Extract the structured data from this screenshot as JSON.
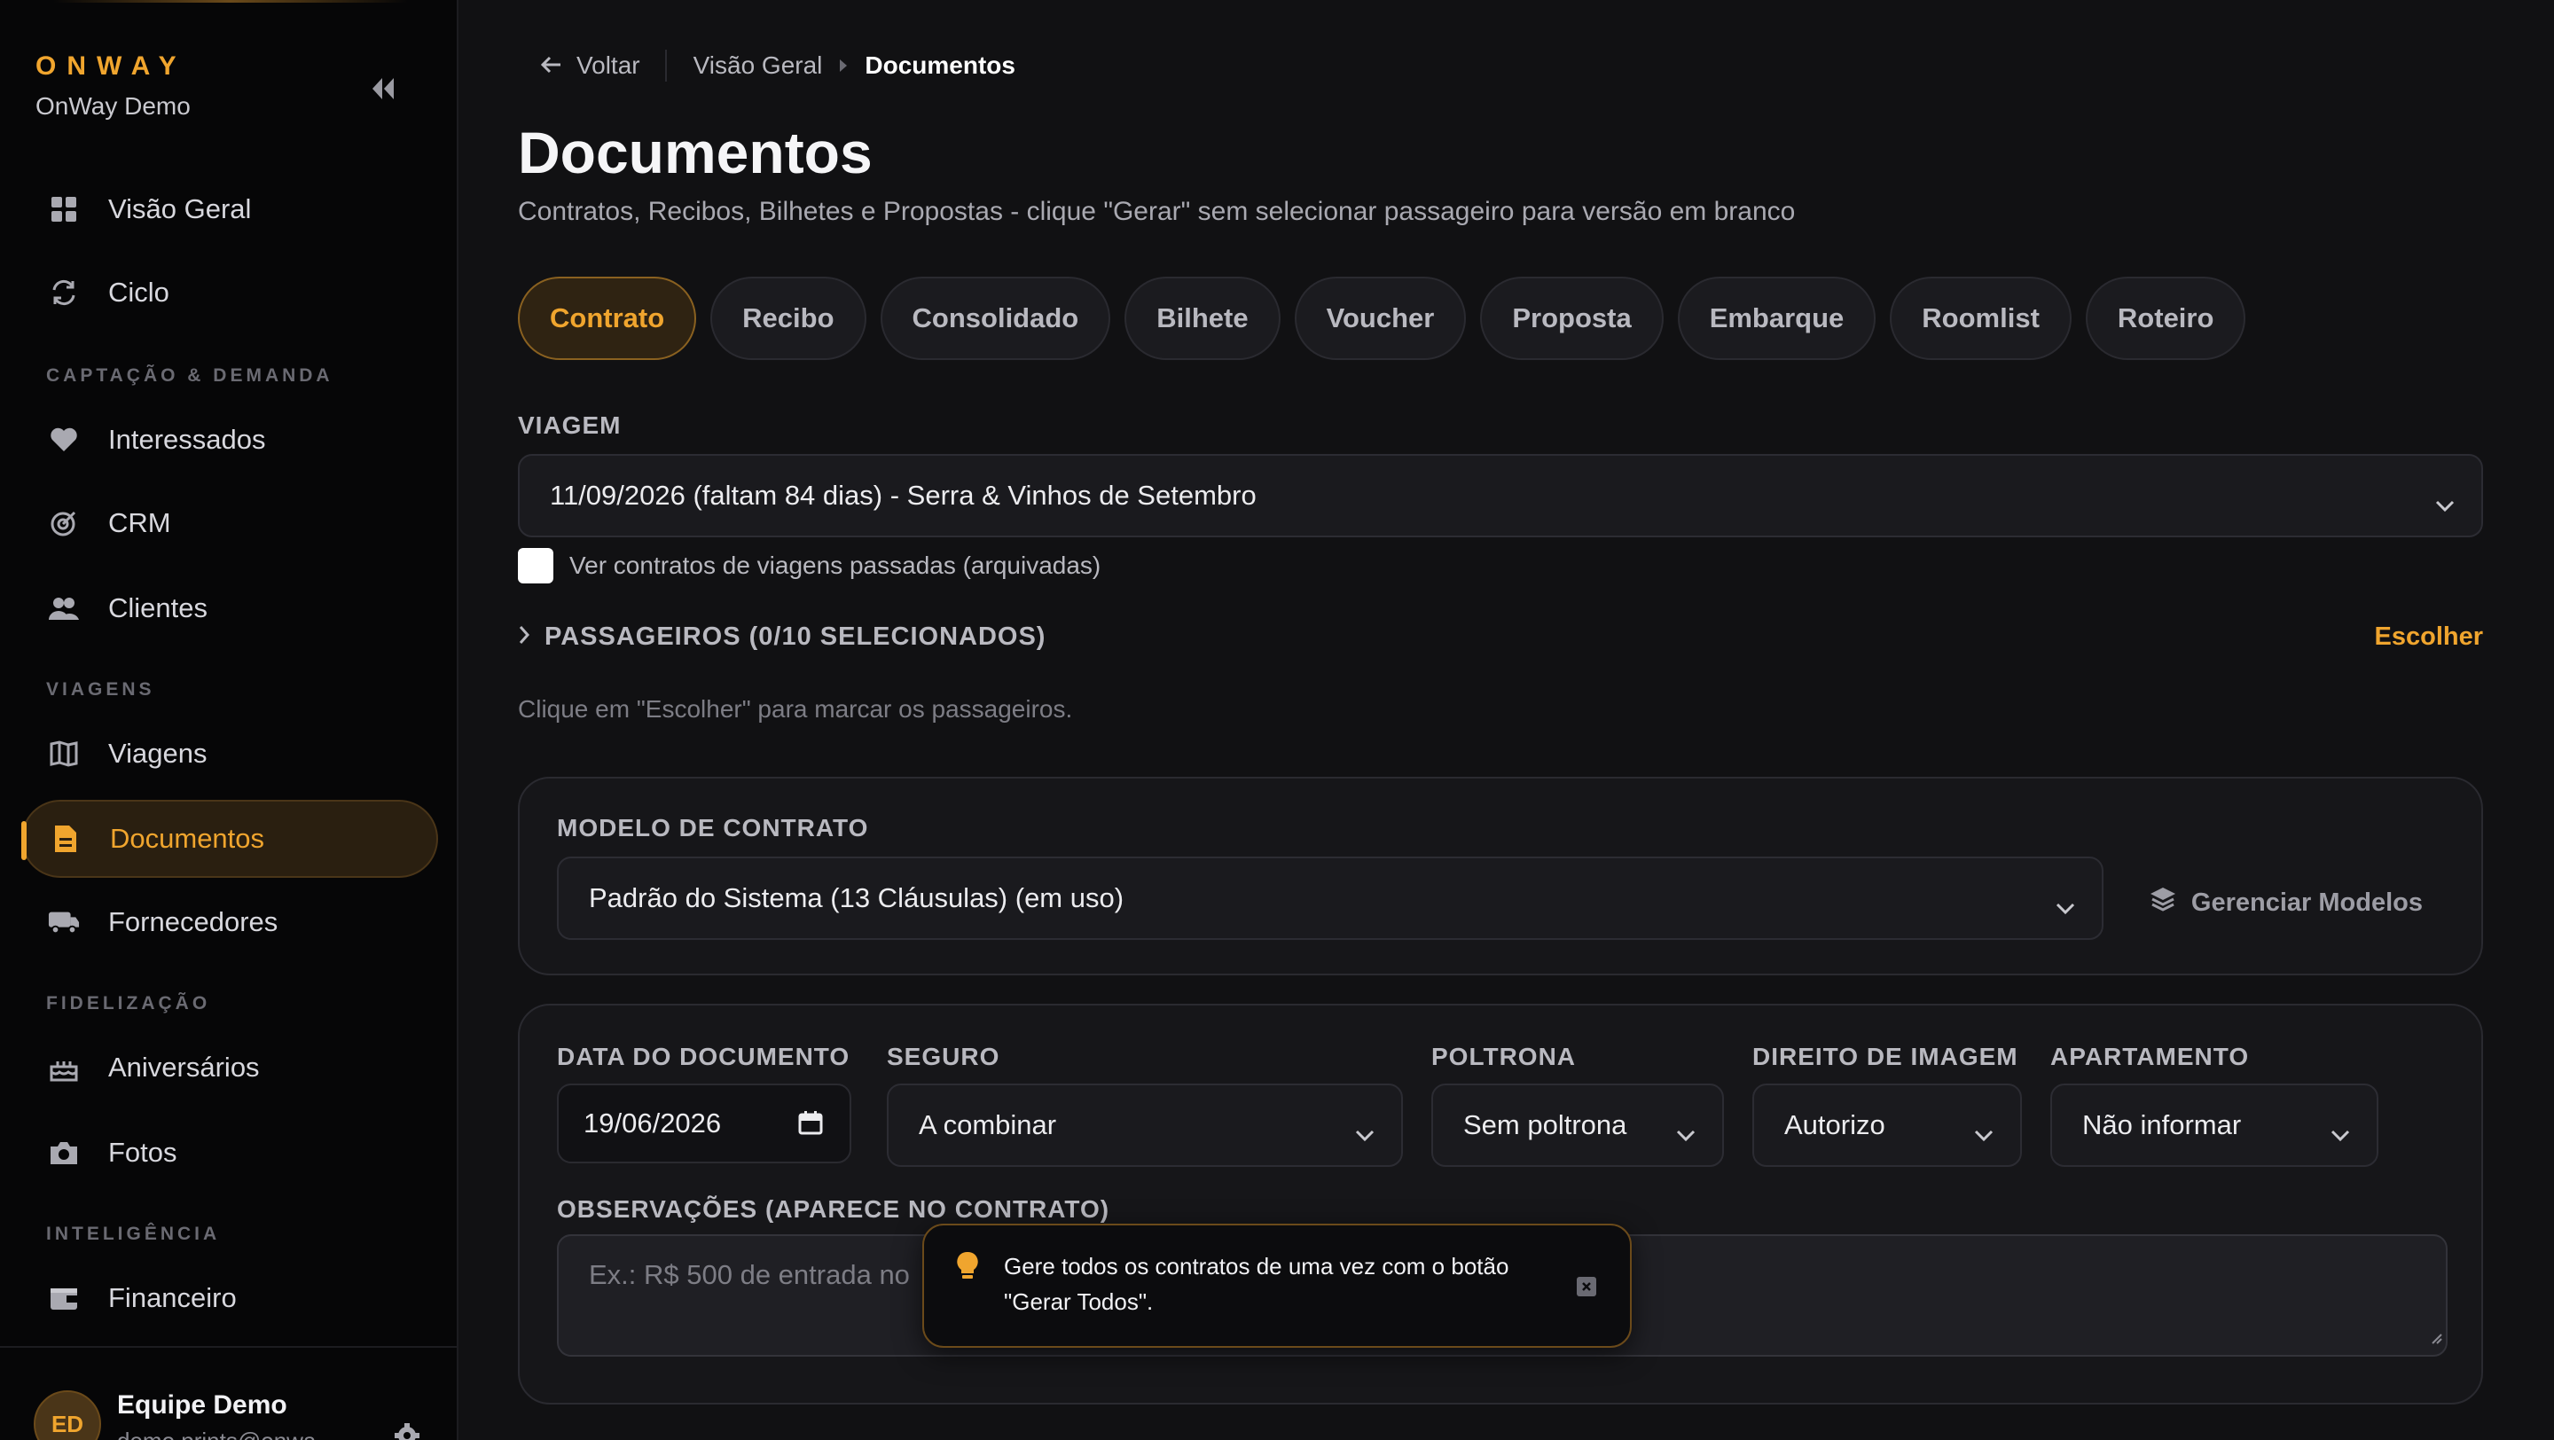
{
  "colors": {
    "accent": "#f0a52e",
    "background": "#111113",
    "sidebar": "#060607"
  },
  "sidebar": {
    "brand": "ONWAY",
    "org": "OnWay Demo",
    "items": [
      {
        "label": "Visão Geral",
        "icon": "grid-icon"
      },
      {
        "label": "Ciclo",
        "icon": "refresh-icon"
      },
      {
        "label": "Interessados",
        "icon": "heart-icon"
      },
      {
        "label": "CRM",
        "icon": "target-icon"
      },
      {
        "label": "Clientes",
        "icon": "users-icon"
      },
      {
        "label": "Viagens",
        "icon": "map-icon"
      },
      {
        "label": "Documentos",
        "icon": "document-icon"
      },
      {
        "label": "Fornecedores",
        "icon": "bus-icon"
      },
      {
        "label": "Aniversários",
        "icon": "cake-icon"
      },
      {
        "label": "Fotos",
        "icon": "camera-icon"
      },
      {
        "label": "Financeiro",
        "icon": "wallet-icon"
      }
    ],
    "sections": [
      "CAPTAÇÃO & DEMANDA",
      "VIAGENS",
      "FIDELIZAÇÃO",
      "INTELIGÊNCIA"
    ],
    "user": {
      "initials": "ED",
      "name": "Equipe Demo",
      "email": "demo.prints@onwa"
    }
  },
  "breadcrumb": {
    "back": "Voltar",
    "parent": "Visão Geral",
    "current": "Documentos"
  },
  "page": {
    "title": "Documentos",
    "subtitle": "Contratos, Recibos, Bilhetes e Propostas - clique \"Gerar\" sem selecionar passageiro para versão em branco"
  },
  "tabs": [
    "Contrato",
    "Recibo",
    "Consolidado",
    "Bilhete",
    "Voucher",
    "Proposta",
    "Embarque",
    "Roomlist",
    "Roteiro"
  ],
  "trip": {
    "label": "VIAGEM",
    "selected": "11/09/2026 (faltam 84 dias) - Serra & Vinhos de Setembro",
    "archived_checkbox": "Ver contratos de viagens passadas (arquivadas)"
  },
  "passengers": {
    "title": "PASSAGEIROS (0/10 SELECIONADOS)",
    "choose": "Escolher",
    "hint": "Clique em \"Escolher\" para marcar os passageiros."
  },
  "contract_model": {
    "label": "MODELO DE CONTRATO",
    "selected": "Padrão do Sistema (13 Cláusulas) (em uso)",
    "manage": "Gerenciar Modelos"
  },
  "options": {
    "date_label": "DATA DO DOCUMENTO",
    "date_value": "19/06/2026",
    "insurance_label": "SEGURO",
    "insurance_value": "A combinar",
    "seat_label": "POLTRONA",
    "seat_value": "Sem poltrona",
    "image_label": "DIREITO DE IMAGEM",
    "image_value": "Autorizo",
    "apartment_label": "APARTAMENTO",
    "apartment_value": "Não informar",
    "notes_label": "OBSERVAÇÕES (APARECE NO CONTRATO)",
    "notes_placeholder": "Ex.: R$ 500 de entrada no"
  },
  "toast": {
    "message": "Gere todos os contratos de uma vez com o botão \"Gerar Todos\"."
  }
}
